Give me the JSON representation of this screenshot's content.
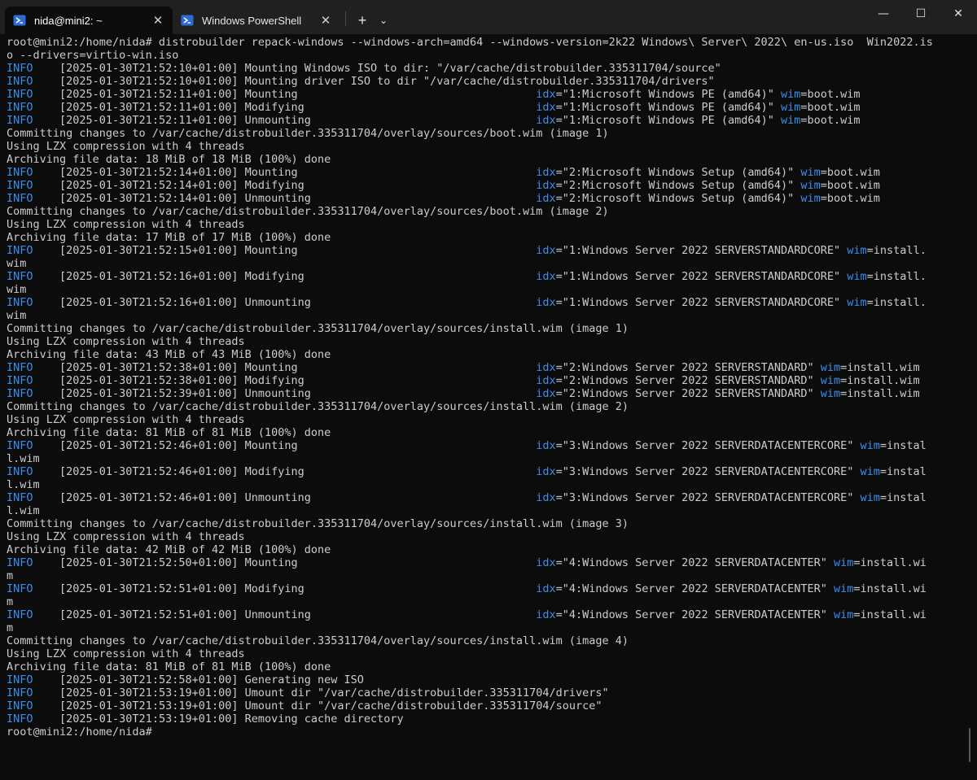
{
  "window": {
    "tabs": [
      {
        "title": "nida@mini2: ~",
        "active": true,
        "icon": "powershell-icon"
      },
      {
        "title": "Windows PowerShell",
        "active": false,
        "icon": "powershell-icon"
      }
    ],
    "new_tab_label": "+",
    "dropdown_label": "⌄",
    "caption": {
      "minimize": "—",
      "maximize": "☐",
      "close": "✕"
    }
  },
  "colors": {
    "background": "#0c0c0c",
    "text": "#cccccc",
    "accent_blue": "#3b8eea",
    "titlebar": "#202020"
  },
  "terminal": {
    "lines": [
      {
        "type": "plain",
        "text": "root@mini2:/home/nida# distrobuilder repack-windows --windows-arch=amd64 --windows-version=2k22 Windows\\ Server\\ 2022\\ en-us.iso  Win2022.is"
      },
      {
        "type": "plain",
        "text": "o --drivers=virtio-win.iso"
      },
      {
        "type": "log",
        "level": "INFO",
        "message": "    [2025-01-30T21:52:10+01:00] Mounting Windows ISO to dir: \"/var/cache/distrobuilder.335311704/source\""
      },
      {
        "type": "log",
        "level": "INFO",
        "message": "    [2025-01-30T21:52:10+01:00] Mounting driver ISO to dir \"/var/cache/distrobuilder.335311704/drivers\""
      },
      {
        "type": "log",
        "level": "INFO",
        "message": "    [2025-01-30T21:52:11+01:00] Mounting                                    ",
        "idx": "\"1:Microsoft Windows PE (amd64)\" ",
        "wim": "boot.wim"
      },
      {
        "type": "log",
        "level": "INFO",
        "message": "    [2025-01-30T21:52:11+01:00] Modifying                                   ",
        "idx": "\"1:Microsoft Windows PE (amd64)\" ",
        "wim": "boot.wim"
      },
      {
        "type": "log",
        "level": "INFO",
        "message": "    [2025-01-30T21:52:11+01:00] Unmounting                                  ",
        "idx": "\"1:Microsoft Windows PE (amd64)\" ",
        "wim": "boot.wim"
      },
      {
        "type": "plain",
        "text": "Committing changes to /var/cache/distrobuilder.335311704/overlay/sources/boot.wim (image 1)"
      },
      {
        "type": "plain",
        "text": "Using LZX compression with 4 threads"
      },
      {
        "type": "plain",
        "text": "Archiving file data: 18 MiB of 18 MiB (100%) done"
      },
      {
        "type": "log",
        "level": "INFO",
        "message": "    [2025-01-30T21:52:14+01:00] Mounting                                    ",
        "idx": "\"2:Microsoft Windows Setup (amd64)\" ",
        "wim": "boot.wim"
      },
      {
        "type": "log",
        "level": "INFO",
        "message": "    [2025-01-30T21:52:14+01:00] Modifying                                   ",
        "idx": "\"2:Microsoft Windows Setup (amd64)\" ",
        "wim": "boot.wim"
      },
      {
        "type": "log",
        "level": "INFO",
        "message": "    [2025-01-30T21:52:14+01:00] Unmounting                                  ",
        "idx": "\"2:Microsoft Windows Setup (amd64)\" ",
        "wim": "boot.wim"
      },
      {
        "type": "plain",
        "text": "Committing changes to /var/cache/distrobuilder.335311704/overlay/sources/boot.wim (image 2)"
      },
      {
        "type": "plain",
        "text": "Using LZX compression with 4 threads"
      },
      {
        "type": "plain",
        "text": "Archiving file data: 17 MiB of 17 MiB (100%) done"
      },
      {
        "type": "log",
        "level": "INFO",
        "message": "    [2025-01-30T21:52:15+01:00] Mounting                                    ",
        "idx": "\"1:Windows Server 2022 SERVERSTANDARDCORE\" ",
        "wim": "install."
      },
      {
        "type": "plain",
        "text": "wim"
      },
      {
        "type": "log",
        "level": "INFO",
        "message": "    [2025-01-30T21:52:16+01:00] Modifying                                   ",
        "idx": "\"1:Windows Server 2022 SERVERSTANDARDCORE\" ",
        "wim": "install."
      },
      {
        "type": "plain",
        "text": "wim"
      },
      {
        "type": "log",
        "level": "INFO",
        "message": "    [2025-01-30T21:52:16+01:00] Unmounting                                  ",
        "idx": "\"1:Windows Server 2022 SERVERSTANDARDCORE\" ",
        "wim": "install."
      },
      {
        "type": "plain",
        "text": "wim"
      },
      {
        "type": "plain",
        "text": "Committing changes to /var/cache/distrobuilder.335311704/overlay/sources/install.wim (image 1)"
      },
      {
        "type": "plain",
        "text": "Using LZX compression with 4 threads"
      },
      {
        "type": "plain",
        "text": "Archiving file data: 43 MiB of 43 MiB (100%) done"
      },
      {
        "type": "log",
        "level": "INFO",
        "message": "    [2025-01-30T21:52:38+01:00] Mounting                                    ",
        "idx": "\"2:Windows Server 2022 SERVERSTANDARD\" ",
        "wim": "install.wim"
      },
      {
        "type": "log",
        "level": "INFO",
        "message": "    [2025-01-30T21:52:38+01:00] Modifying                                   ",
        "idx": "\"2:Windows Server 2022 SERVERSTANDARD\" ",
        "wim": "install.wim"
      },
      {
        "type": "log",
        "level": "INFO",
        "message": "    [2025-01-30T21:52:39+01:00] Unmounting                                  ",
        "idx": "\"2:Windows Server 2022 SERVERSTANDARD\" ",
        "wim": "install.wim"
      },
      {
        "type": "plain",
        "text": "Committing changes to /var/cache/distrobuilder.335311704/overlay/sources/install.wim (image 2)"
      },
      {
        "type": "plain",
        "text": "Using LZX compression with 4 threads"
      },
      {
        "type": "plain",
        "text": "Archiving file data: 81 MiB of 81 MiB (100%) done"
      },
      {
        "type": "log",
        "level": "INFO",
        "message": "    [2025-01-30T21:52:46+01:00] Mounting                                    ",
        "idx": "\"3:Windows Server 2022 SERVERDATACENTERCORE\" ",
        "wim": "instal"
      },
      {
        "type": "plain",
        "text": "l.wim"
      },
      {
        "type": "log",
        "level": "INFO",
        "message": "    [2025-01-30T21:52:46+01:00] Modifying                                   ",
        "idx": "\"3:Windows Server 2022 SERVERDATACENTERCORE\" ",
        "wim": "instal"
      },
      {
        "type": "plain",
        "text": "l.wim"
      },
      {
        "type": "log",
        "level": "INFO",
        "message": "    [2025-01-30T21:52:46+01:00] Unmounting                                  ",
        "idx": "\"3:Windows Server 2022 SERVERDATACENTERCORE\" ",
        "wim": "instal"
      },
      {
        "type": "plain",
        "text": "l.wim"
      },
      {
        "type": "plain",
        "text": "Committing changes to /var/cache/distrobuilder.335311704/overlay/sources/install.wim (image 3)"
      },
      {
        "type": "plain",
        "text": "Using LZX compression with 4 threads"
      },
      {
        "type": "plain",
        "text": "Archiving file data: 42 MiB of 42 MiB (100%) done"
      },
      {
        "type": "log",
        "level": "INFO",
        "message": "    [2025-01-30T21:52:50+01:00] Mounting                                    ",
        "idx": "\"4:Windows Server 2022 SERVERDATACENTER\" ",
        "wim": "install.wi"
      },
      {
        "type": "plain",
        "text": "m"
      },
      {
        "type": "log",
        "level": "INFO",
        "message": "    [2025-01-30T21:52:51+01:00] Modifying                                   ",
        "idx": "\"4:Windows Server 2022 SERVERDATACENTER\" ",
        "wim": "install.wi"
      },
      {
        "type": "plain",
        "text": "m"
      },
      {
        "type": "log",
        "level": "INFO",
        "message": "    [2025-01-30T21:52:51+01:00] Unmounting                                  ",
        "idx": "\"4:Windows Server 2022 SERVERDATACENTER\" ",
        "wim": "install.wi"
      },
      {
        "type": "plain",
        "text": "m"
      },
      {
        "type": "plain",
        "text": "Committing changes to /var/cache/distrobuilder.335311704/overlay/sources/install.wim (image 4)"
      },
      {
        "type": "plain",
        "text": "Using LZX compression with 4 threads"
      },
      {
        "type": "plain",
        "text": "Archiving file data: 81 MiB of 81 MiB (100%) done"
      },
      {
        "type": "log",
        "level": "INFO",
        "message": "    [2025-01-30T21:52:58+01:00] Generating new ISO"
      },
      {
        "type": "log",
        "level": "INFO",
        "message": "    [2025-01-30T21:53:19+01:00] Umount dir \"/var/cache/distrobuilder.335311704/drivers\""
      },
      {
        "type": "log",
        "level": "INFO",
        "message": "    [2025-01-30T21:53:19+01:00] Umount dir \"/var/cache/distrobuilder.335311704/source\""
      },
      {
        "type": "log",
        "level": "INFO",
        "message": "    [2025-01-30T21:53:19+01:00] Removing cache directory"
      },
      {
        "type": "plain",
        "text": "root@mini2:/home/nida#"
      }
    ]
  }
}
